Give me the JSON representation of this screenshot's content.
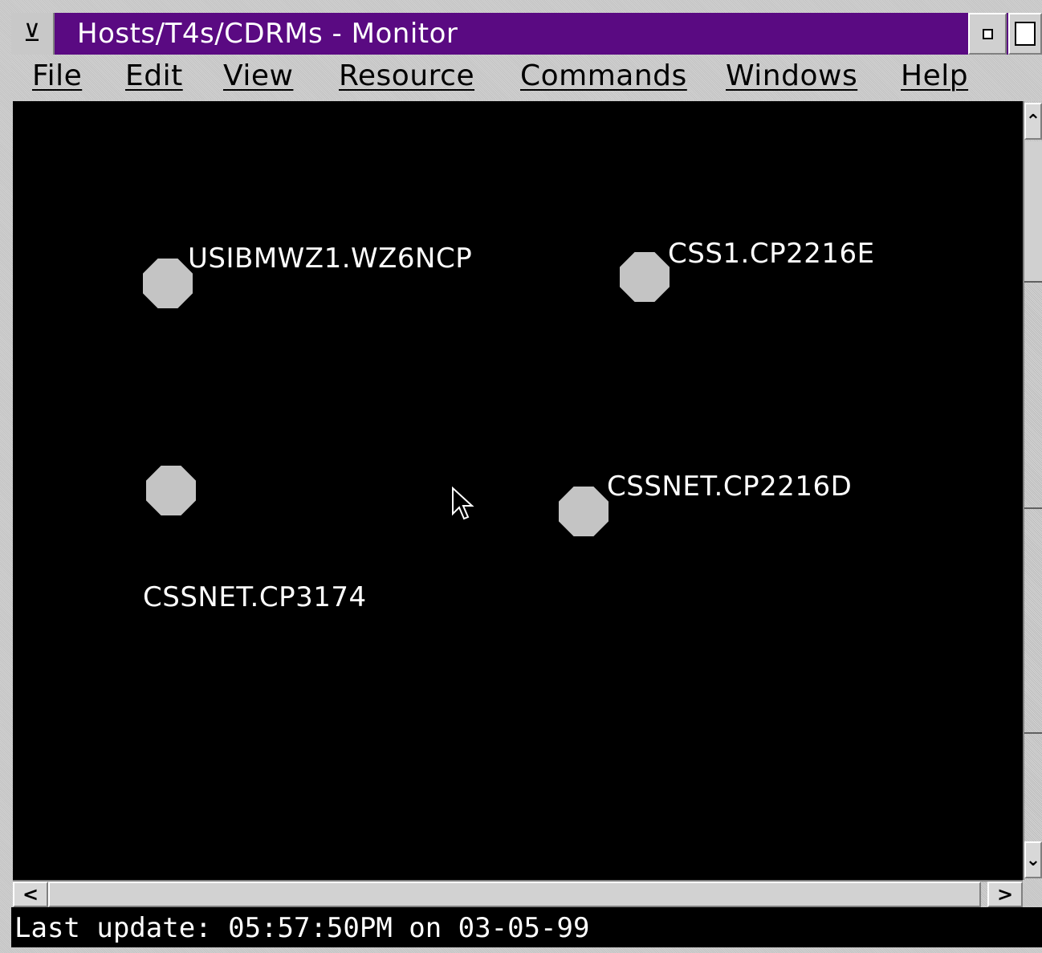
{
  "window": {
    "title": "Hosts/T4s/CDRMs - Monitor",
    "system_menu_glyph": "⊻",
    "title_bar_color": "#5a0a82"
  },
  "menubar": {
    "items": [
      {
        "label": "File"
      },
      {
        "label": "Edit"
      },
      {
        "label": "View"
      },
      {
        "label": "Resource"
      },
      {
        "label": "Commands"
      },
      {
        "label": "Windows"
      },
      {
        "label": "Help"
      }
    ]
  },
  "canvas": {
    "background": "#000000",
    "nodes": [
      {
        "label": "USIBMWZ1.WZ6NCP",
        "color": "#c4c4c4"
      },
      {
        "label": "CSS1.CP2216E",
        "color": "#c4c4c4"
      },
      {
        "label": "CSSNET.CP3174",
        "color": "#c4c4c4"
      },
      {
        "label": "CSSNET.CP2216D",
        "color": "#c4c4c4"
      }
    ]
  },
  "scrollbars": {
    "up_glyph": "⌃",
    "down_glyph": "⌄",
    "left_glyph": "<",
    "right_glyph": ">"
  },
  "status": {
    "text": "Last update: 05:57:50PM on 03-05-99"
  }
}
